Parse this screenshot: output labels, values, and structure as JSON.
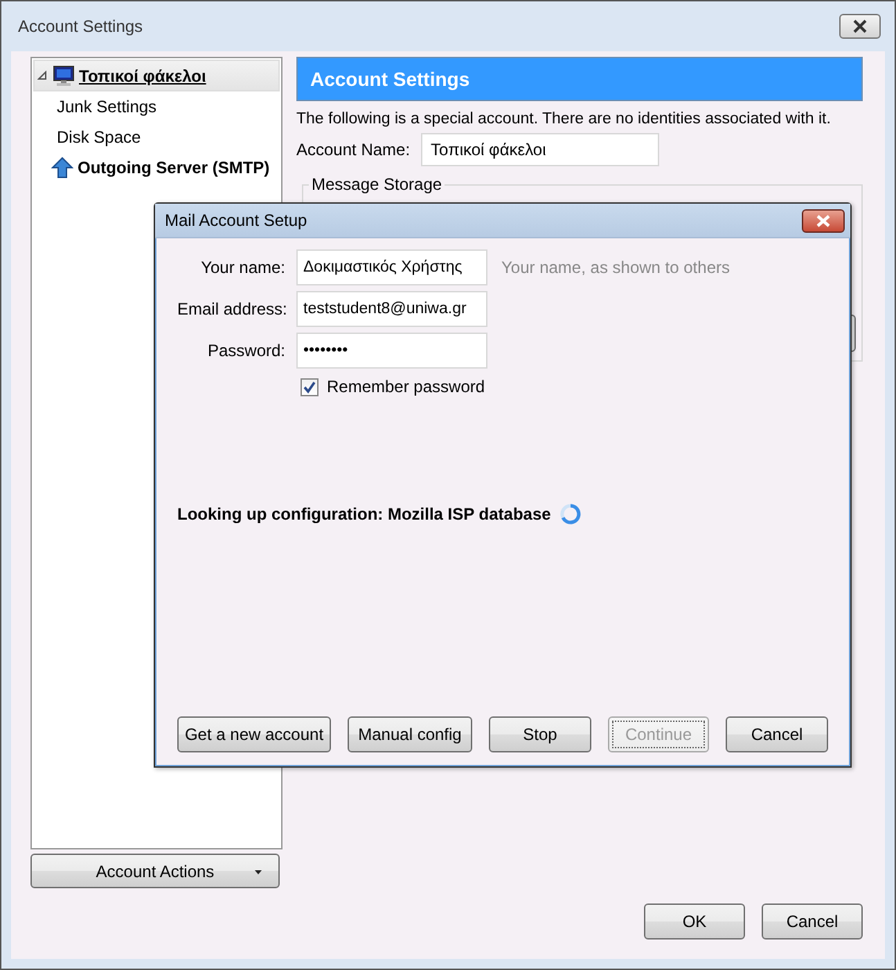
{
  "window": {
    "title": "Account Settings"
  },
  "tree": [
    {
      "label": "Τοπικοί φάκελοι",
      "kind": "account",
      "selected": true,
      "expanded": true,
      "children": [
        {
          "label": "Junk Settings",
          "selected": false
        },
        {
          "label": "Disk Space",
          "selected": false
        }
      ]
    },
    {
      "label": "Outgoing Server (SMTP)",
      "kind": "server",
      "selected": false
    }
  ],
  "account_actions": "Account Actions",
  "panel": {
    "title": "Account Settings",
    "description": "The following is a special account. There are no identities associated with it.",
    "account_name": {
      "label": "Account Name:",
      "value": "Τοπικοί φάκελοι"
    },
    "group_title": "Message Storage"
  },
  "dialog": {
    "title": "Mail Account Setup",
    "fields": [
      {
        "label": "Your name:",
        "value": "Δοκιμαστικός Χρήστης",
        "hint": "Your name, as shown to others"
      },
      {
        "label": "Email address:",
        "value": "teststudent8@uniwa.gr"
      },
      {
        "label": "Password:",
        "value": "••••••••"
      }
    ],
    "remember": {
      "label": "Remember password",
      "checked": true
    },
    "status": "Looking up configuration: Mozilla ISP database",
    "buttons": [
      {
        "label": "Get a new account",
        "disabled": false
      },
      {
        "label": "Manual config",
        "disabled": false
      },
      {
        "label": "Stop",
        "disabled": false
      },
      {
        "label": "Continue",
        "disabled": true
      },
      {
        "label": "Cancel",
        "disabled": false
      }
    ]
  },
  "buttons": [
    "OK",
    "Cancel"
  ]
}
